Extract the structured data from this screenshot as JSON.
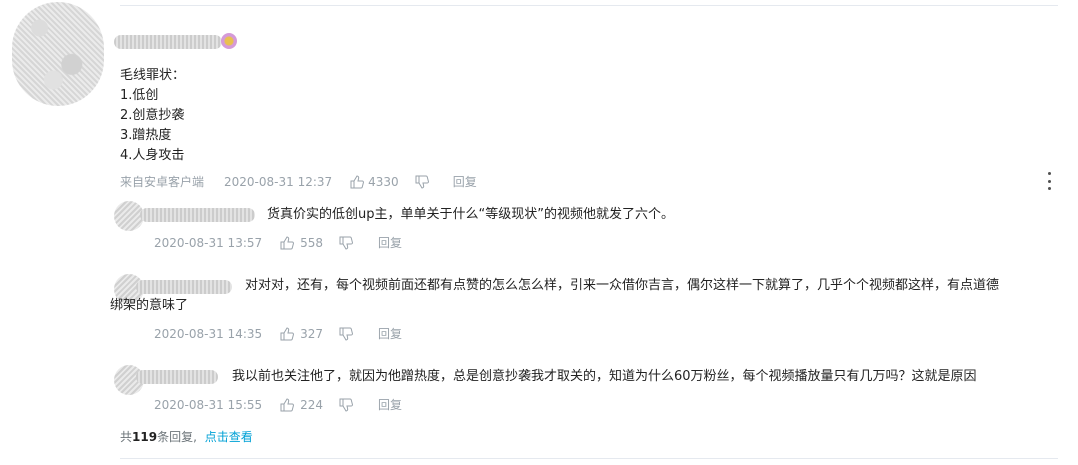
{
  "main_comment": {
    "title": "毛线罪状：",
    "items": [
      "1.低创",
      "2.创意抄袭",
      "3.蹭热度",
      "4.人身攻击"
    ],
    "source": "来自安卓客户端",
    "time": "2020-08-31 12:37",
    "likes": "4330",
    "reply_label": "回复"
  },
  "replies": [
    {
      "text": "货真价实的低创up主，单单关于什么“等级现状”的视频他就发了六个。",
      "time": "2020-08-31 13:57",
      "likes": "558",
      "reply_label": "回复"
    },
    {
      "text_line1": "对对对，还有，每个视频前面还都有点赞的怎么怎么样，引来一众借你吉言，偶尔这样一下就算了，几乎个个视频都这样，有点道德",
      "text_line2": "绑架的意味了",
      "time": "2020-08-31 14:35",
      "likes": "327",
      "reply_label": "回复"
    },
    {
      "text": "我以前也关注他了，就因为他蹭热度，总是创意抄袭我才取关的，知道为什么60万粉丝，每个视频播放量只有几万吗？这就是原因",
      "time": "2020-08-31 15:55",
      "likes": "224",
      "reply_label": "回复"
    }
  ],
  "footer": {
    "prefix": "共",
    "count": "119",
    "suffix": "条回复,",
    "view_link": "点击查看"
  },
  "colors": {
    "meta_gray": "#99a2aa",
    "link_blue": "#00a1d6",
    "divider": "#e5e9ef"
  }
}
